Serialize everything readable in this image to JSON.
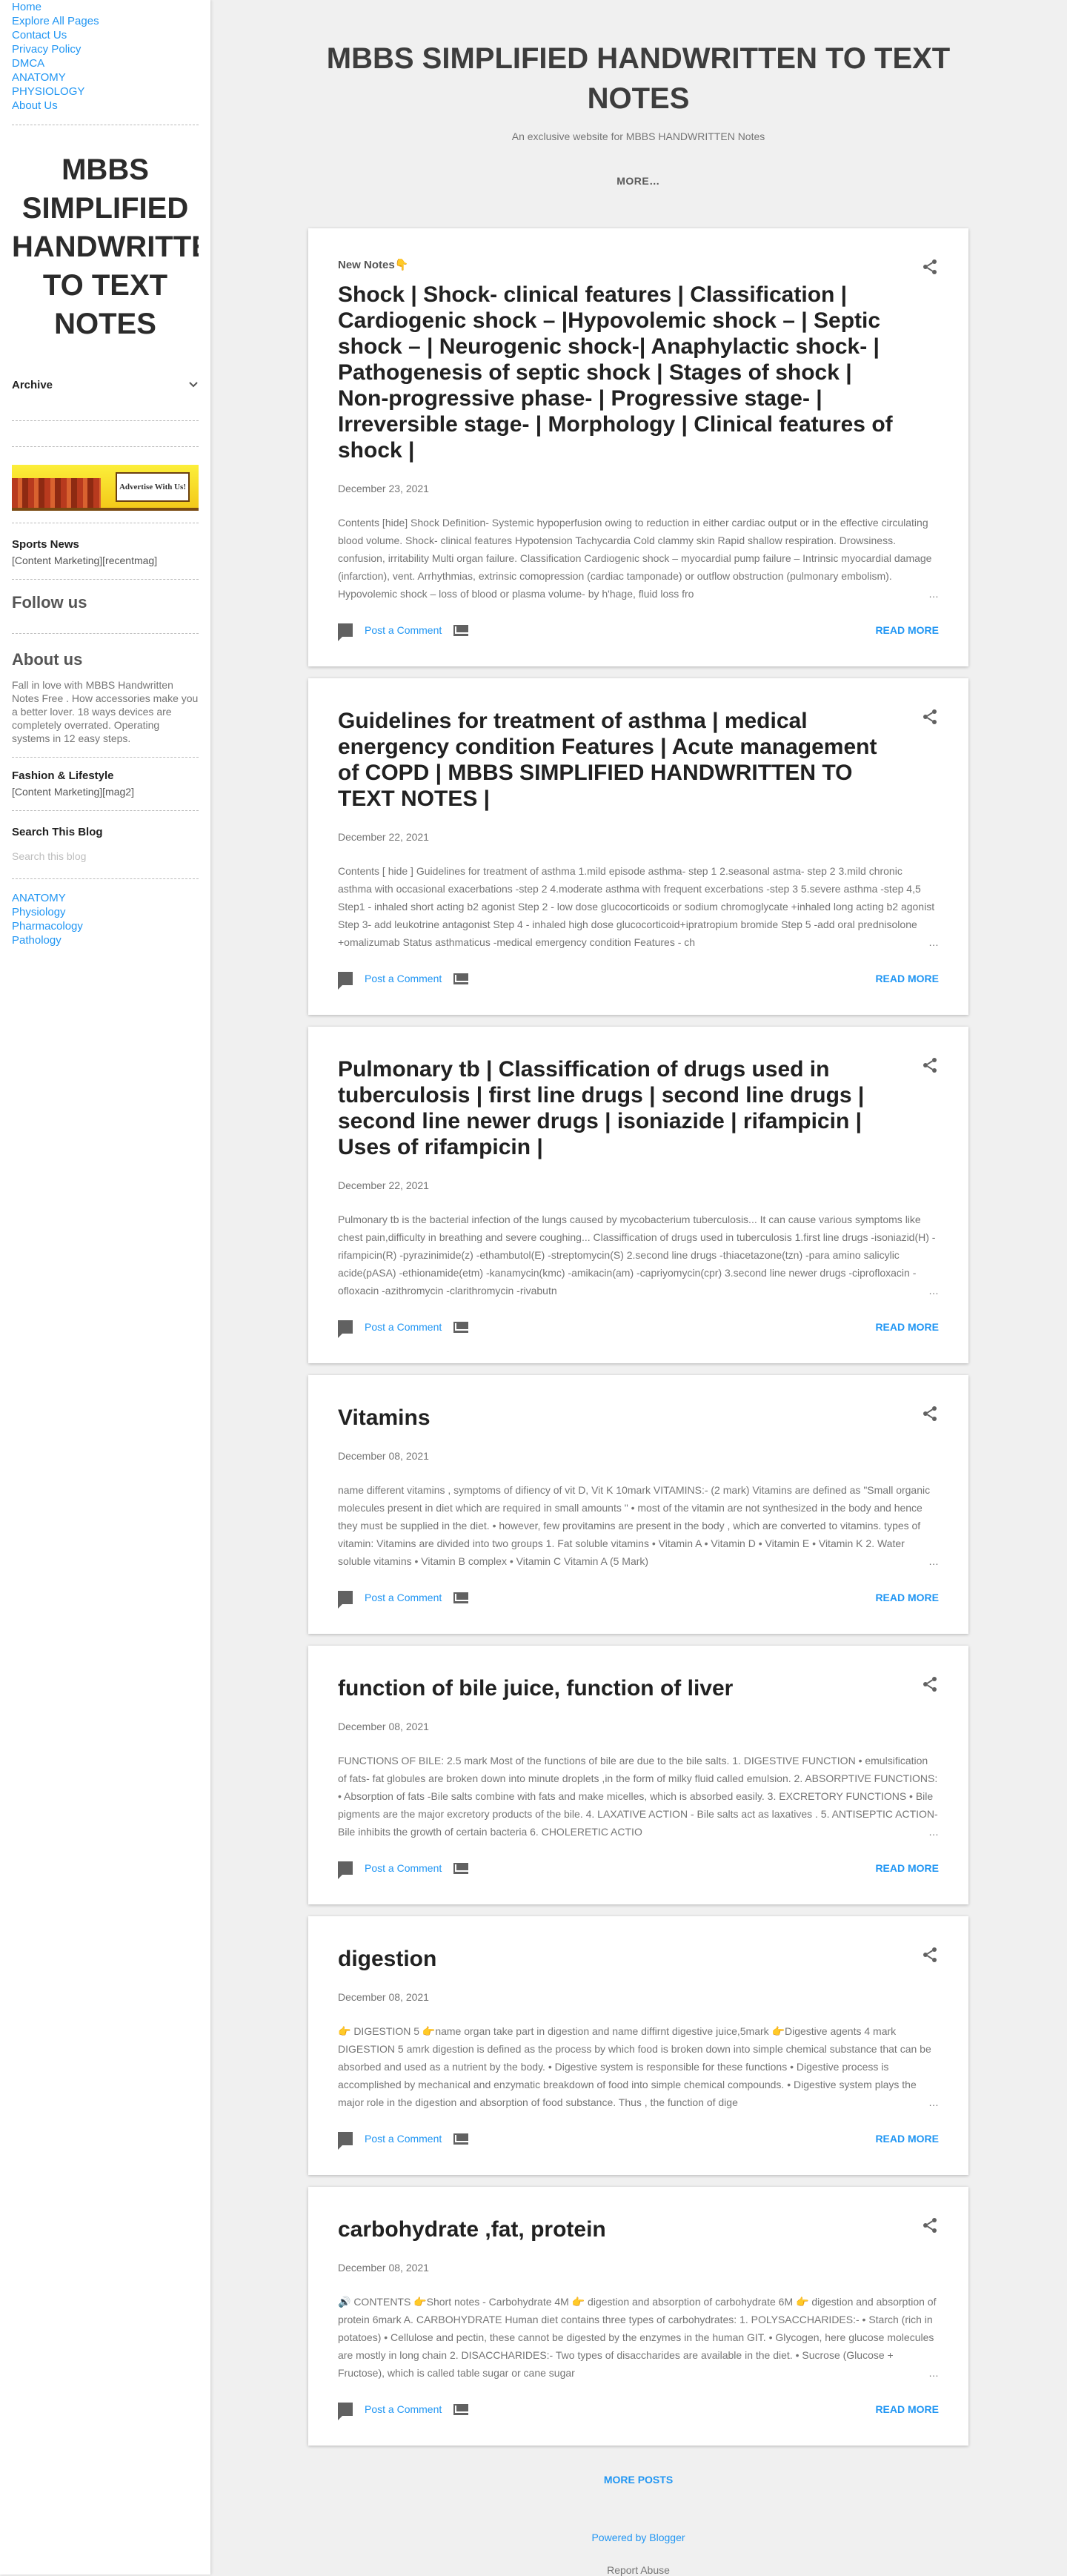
{
  "sidebar": {
    "links": [
      "Home",
      "Explore All Pages",
      "Contact Us",
      "Privacy Policy",
      "DMCA",
      "ANATOMY",
      "PHYSIOLOGY",
      "About Us"
    ],
    "title": "MBBS SIMPLIFIED HANDWRITTEN TO TEXT NOTES",
    "archive": "Archive",
    "banner_sign": "Advertise With Us!",
    "sports_title": "Sports News",
    "sports_text": "[Content Marketing][recentmag]",
    "follow": "Follow us",
    "about_title": "About us",
    "about_text": "Fall in love with MBBS Handwritten Notes Free . How accessories make you a better lover. 18 ways devices are completely overrated. Operating systems in 12 easy steps.",
    "fashion_title": "Fashion & Lifestyle",
    "fashion_text": "[Content Marketing][mag2]",
    "search_title": "Search This Blog",
    "search_placeholder": "Search this blog",
    "labels": [
      "ANATOMY",
      "Physiology",
      "Pharmacology",
      "Pathology"
    ]
  },
  "header": {
    "title": "MBBS SIMPLIFIED HANDWRITTEN TO TEXT NOTES",
    "description": "An exclusive website for MBBS HANDWRITTEN Notes",
    "more": "MORE…"
  },
  "post_actions": {
    "comment": "Post a Comment",
    "read_more": "READ MORE"
  },
  "posts": [
    {
      "kicker": "New Notes👇",
      "title": "Shock | Shock- clinical features | Classification | Cardiogenic shock – |Hypovolemic shock – | Septic shock – | Neurogenic shock-| Anaphylactic shock-  | Pathogenesis of septic shock | Stages of shock | Non-progressive phase- | Progressive stage-  | Irreversible stage- | Morphology | Clinical features of shock |",
      "date": "December 23, 2021",
      "snippet": "Contents [hide]  Shock  Definition- Systemic hypoperfusion owing to reduction in either cardiac output or in the effective circulating blood volume. Shock- clinical features Hypotension Tachycardia Cold clammy skin Rapid shallow respiration. Drowsiness.  confusion, irritability Multi organ failure. Classification  Cardiogenic shock –  myocardial pump failure – Intrinsic myocardial damage (infarction), vent. Arrhythmias,  extrinsic comopression (cardiac tamponade) or outflow obstruction (pulmonary embolism). Hypovolemic shock –  loss of blood or plasma volume-  by h'hage, fluid loss fro"
    },
    {
      "kicker": "",
      "title": "Guidelines for treatment of asthma | medical energency condition Features | Acute management of COPD  | MBBS SIMPLIFIED HANDWRITTEN TO TEXT NOTES |",
      "date": "December 22, 2021",
      "snippet": "Contents [ hide ] Guidelines for treatment of asthma   1.mild episode asthma- step 1   2.seasonal astma- step 2  3.mild chronic asthma with occasional exacerbations -step 2   4.moderate asthma with frequent excerbations -step 3  5.severe asthma -step 4,5 Step1 - inhaled short acting b2 agonist  Step 2 - low dose glucocorticoids or sodium chromoglycate +inhaled long acting b2 agonist  Step 3- add leukotrine antagonist  Step 4 - inhaled high dose glucocorticoid+ipratropium bromide  Step 5 -add oral prednisolone +omalizumab Status asthmaticus  -medical emergency condition Features  - ch"
    },
    {
      "kicker": "",
      "title": "Pulmonary tb | Classiffication of drugs used in tuberculosis  | first line drugs | second line drugs  | second line newer drugs  | isoniazide | rifampicin | Uses of rifampicin  |",
      "date": "December 22, 2021",
      "snippet": "Pulmonary tb is the bacterial infection of the lungs caused by mycobacterium tuberculosis... It can cause various symptoms like chest pain,difficulty in breathing and severe coughing... Classiffication of drugs used in tuberculosis 1.first line drugs  -isoniazid(H)  -rifampicin(R)  -pyrazinimide(z)  -ethambutol(E)  -streptomycin(S)  2.second line drugs  -thiacetazone(tzn)  -para amino salicylic acide(pASA)  -ethionamide(etm)  -kanamycin(kmc)  -amikacin(am)  -capriyomycin(cpr)  3.second line newer drugs  -ciprofloxacin  -ofloxacin  -azithromycin  -clarithromycin  -rivabutn"
    },
    {
      "kicker": "",
      "title": "Vitamins",
      "date": "December 08, 2021",
      "snippet": " name different vitamins , symptoms of difiency of vit D, Vit K 10mark VITAMINS:- (2 mark) Vitamins are defined as \"Small organic molecules present in diet which are required in small amounts \"  • most of the vitamin are not synthesized in the body and hence they must be supplied in the diet.  • however, few provitamins are present in the body , which are converted to vitamins. types of vitamin: Vitamins are divided into two groups  1. Fat soluble vitamins  • Vitamin A  • Vitamin D   • Vitamin E   • Vitamin K  2. Water soluble vitamins   • Vitamin B complex  • Vitamin C Vitamin A (5 Mark)"
    },
    {
      "kicker": "",
      "title": "function of bile juice, function of liver",
      "date": "December 08, 2021",
      "snippet": " FUNCTIONS OF BILE: 2.5 mark Most of the functions of bile are due to the bile salts.  1. DIGESTIVE FUNCTION  • emulsification of fats- fat globules are broken down into minute droplets ,in the form of milky fluid called emulsion.  2. ABSORPTIVE FUNCTIONS:  • Absorption of fats -Bile salts combine with fats and make micelles, which is absorbed easily.  3. EXCRETORY FUNCTIONS  • Bile pigments are the major excretory products of the bile.  4. LAXATIVE ACTION - Bile salts act as laxatives .  5. ANTISEPTIC ACTION-Bile inhibits the growth of certain bacteria  6. CHOLERETIC ACTIO"
    },
    {
      "kicker": "",
      "title": "digestion",
      "date": "December 08, 2021",
      "snippet": "👉 DIGESTION 5 👉name organ take part in digestion and name diffirnt digestive juice,5mark 👉Digestive agents 4 mark DIGESTION 5 amrk digestion is defined as the process by which food is broken down into simple chemical substance that can be absorbed and used as a nutrient by the body.  • Digestive system is responsible for these functions  • Digestive process is accomplished by mechanical and enzymatic breakdown of food into simple chemical compounds.  • Digestive system plays the major role in the digestion and absorption of food substance. Thus , the function of dige"
    },
    {
      "kicker": "",
      "title": "carbohydrate ,fat, protein",
      "date": "December 08, 2021",
      "snippet": "🔊 CONTENTS 👉Short notes - Carbohydrate 4M 👉 digestion and absorption of carbohydrate 6M 👉 digestion and absorption of protein 6mark  A. CARBOHYDRATE Human diet contains three types of carbohydrates:  1. POLYSACCHARIDES:-  • Starch (rich in potatoes)  • Cellulose and pectin, these cannot be digested by the enzymes in the human GIT.  • Glycogen, here glucose molecules are mostly in long chain  2. DISACCHARIDES:-  Two types of disaccharides are available in the diet.  • Sucrose (Glucose + Fructose), which is called table sugar or cane sugar"
    }
  ],
  "footer": {
    "more_posts": "MORE POSTS",
    "powered": "Powered by Blogger",
    "report": "Report Abuse"
  }
}
